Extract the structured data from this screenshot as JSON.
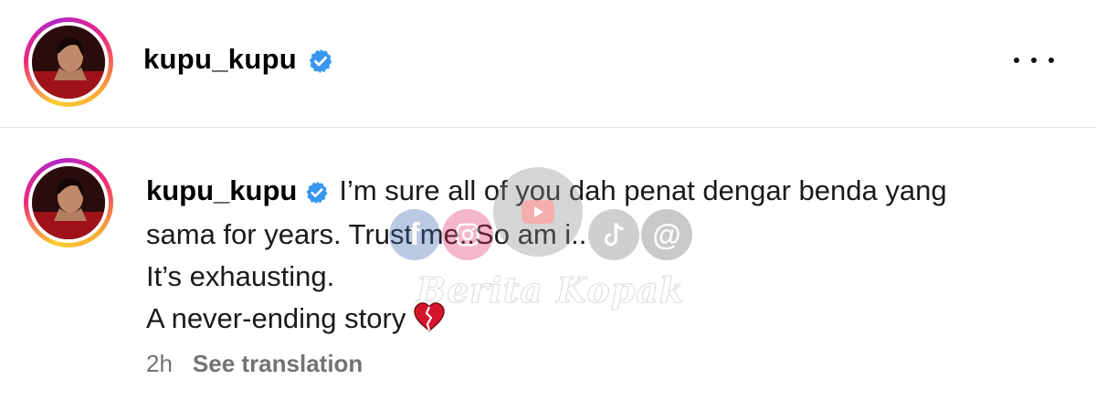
{
  "header": {
    "username": "kupu_kupu",
    "verified_icon": "verified-badge-icon",
    "more_icon": "more-options-icon"
  },
  "comment": {
    "username": "kupu_kupu",
    "lines": [
      "I’m sure all of you dah penat dengar benda yang",
      "sama for years. Trust me..So am i..",
      "It’s exhausting.",
      "A never-ending story"
    ],
    "emoji": "broken-heart-icon",
    "timestamp": "2h",
    "see_translation": "See translation"
  },
  "watermark": {
    "text": "Berita Kopak",
    "icons": [
      "facebook-icon",
      "instagram-icon",
      "youtube-icon",
      "tiktok-icon",
      "threads-icon"
    ]
  },
  "colors": {
    "verified": "#3897f0",
    "meta_text": "#737373",
    "heart": "#d4162c"
  }
}
